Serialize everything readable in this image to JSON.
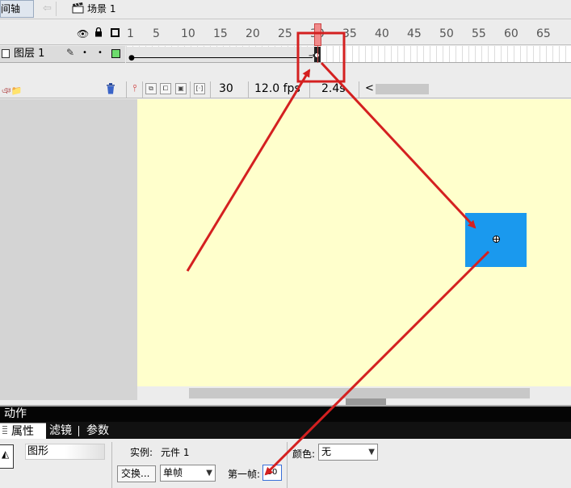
{
  "topbar": {
    "timeline_tab": "时间轴",
    "back_icon": "arrow-left-icon",
    "scene_icon": "clapperboard-icon",
    "scene_label": "场景 1"
  },
  "timeline": {
    "ruler_labels": [
      "1",
      "5",
      "10",
      "15",
      "20",
      "25",
      "30",
      "35",
      "40",
      "45",
      "50",
      "55",
      "60",
      "65"
    ],
    "layer_name": "图层 1",
    "layer_color": "#6ddc6d",
    "current_frame": "30",
    "fps": "12.0 fps",
    "elapsed": "2.4s",
    "scroll_left": "<",
    "tween_end_frame": 30
  },
  "stage": {
    "background": "#ffffcc",
    "symbol_color": "#1a99ee"
  },
  "panels": {
    "actions_label": "动作",
    "tabs": {
      "properties": "属性",
      "filters": "滤镜",
      "parameters": "参数"
    },
    "symbol_type": "图形",
    "instance_label": "实例:",
    "instance_value": "元件 1",
    "swap_button": "交换...",
    "loop_option": "单帧",
    "first_frame_label": "第一帧:",
    "first_frame_value": "30",
    "color_label": "颜色:",
    "color_value": "无"
  },
  "annotations": {
    "color": "#d42020"
  }
}
